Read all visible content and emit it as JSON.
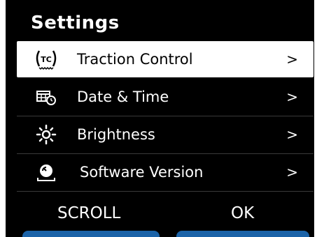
{
  "screen": {
    "title": "Settings",
    "items": [
      {
        "label": "Traction Control",
        "icon": "traction-control-icon",
        "chevron": ">"
      },
      {
        "label": "Date & Time",
        "icon": "calendar-clock-icon",
        "chevron": ">"
      },
      {
        "label": "Brightness",
        "icon": "brightness-icon",
        "chevron": ">"
      },
      {
        "label": "Software Version",
        "icon": "software-version-icon",
        "chevron": ">"
      }
    ],
    "softkeys": {
      "left": "SCROLL",
      "right": "OK"
    }
  },
  "colors": {
    "background": "#000000",
    "selected_background": "#ffffff",
    "softkey_bar": "#1b63a8",
    "text": "#ffffff"
  }
}
